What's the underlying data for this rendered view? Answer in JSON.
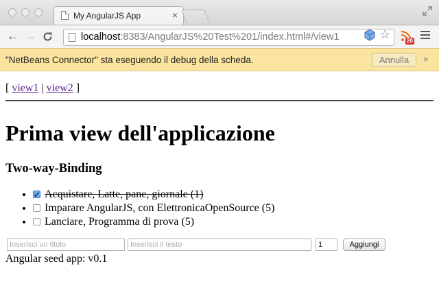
{
  "browser": {
    "tab_title": "My AngularJS App",
    "tab_close": "×",
    "url_host": "localhost",
    "url_rest": ":8383/AngularJS%20Test%201/index.html#/view1",
    "rss_badge": "20",
    "nav": {
      "back": "←",
      "forward": "→",
      "reload": "C"
    }
  },
  "infobar": {
    "message": "\"NetBeans Connector\" sta eseguendo il debug della scheda.",
    "cancel_label": "Annulla",
    "close": "×"
  },
  "page": {
    "menu": {
      "open": "[",
      "link1": "view1",
      "sep": "|",
      "link2": "view2",
      "close": "]"
    },
    "heading": "Prima view dell'applicazione",
    "subheading": "Two-way-Binding",
    "todos": [
      {
        "text": "Acquistare, Latte, pane, giornale (1)",
        "done": true
      },
      {
        "text": "Imparare AngularJS, con ElettronicaOpenSource (5)",
        "done": false
      },
      {
        "text": "Lanciare, Programma di prova (5)",
        "done": false
      }
    ],
    "form": {
      "title_placeholder": "Inserisci un titolo",
      "text_placeholder": "Inserisci il testo",
      "priority_value": "1",
      "add_label": "Aggiungi"
    },
    "footer": "Angular seed app: v0.1"
  }
}
